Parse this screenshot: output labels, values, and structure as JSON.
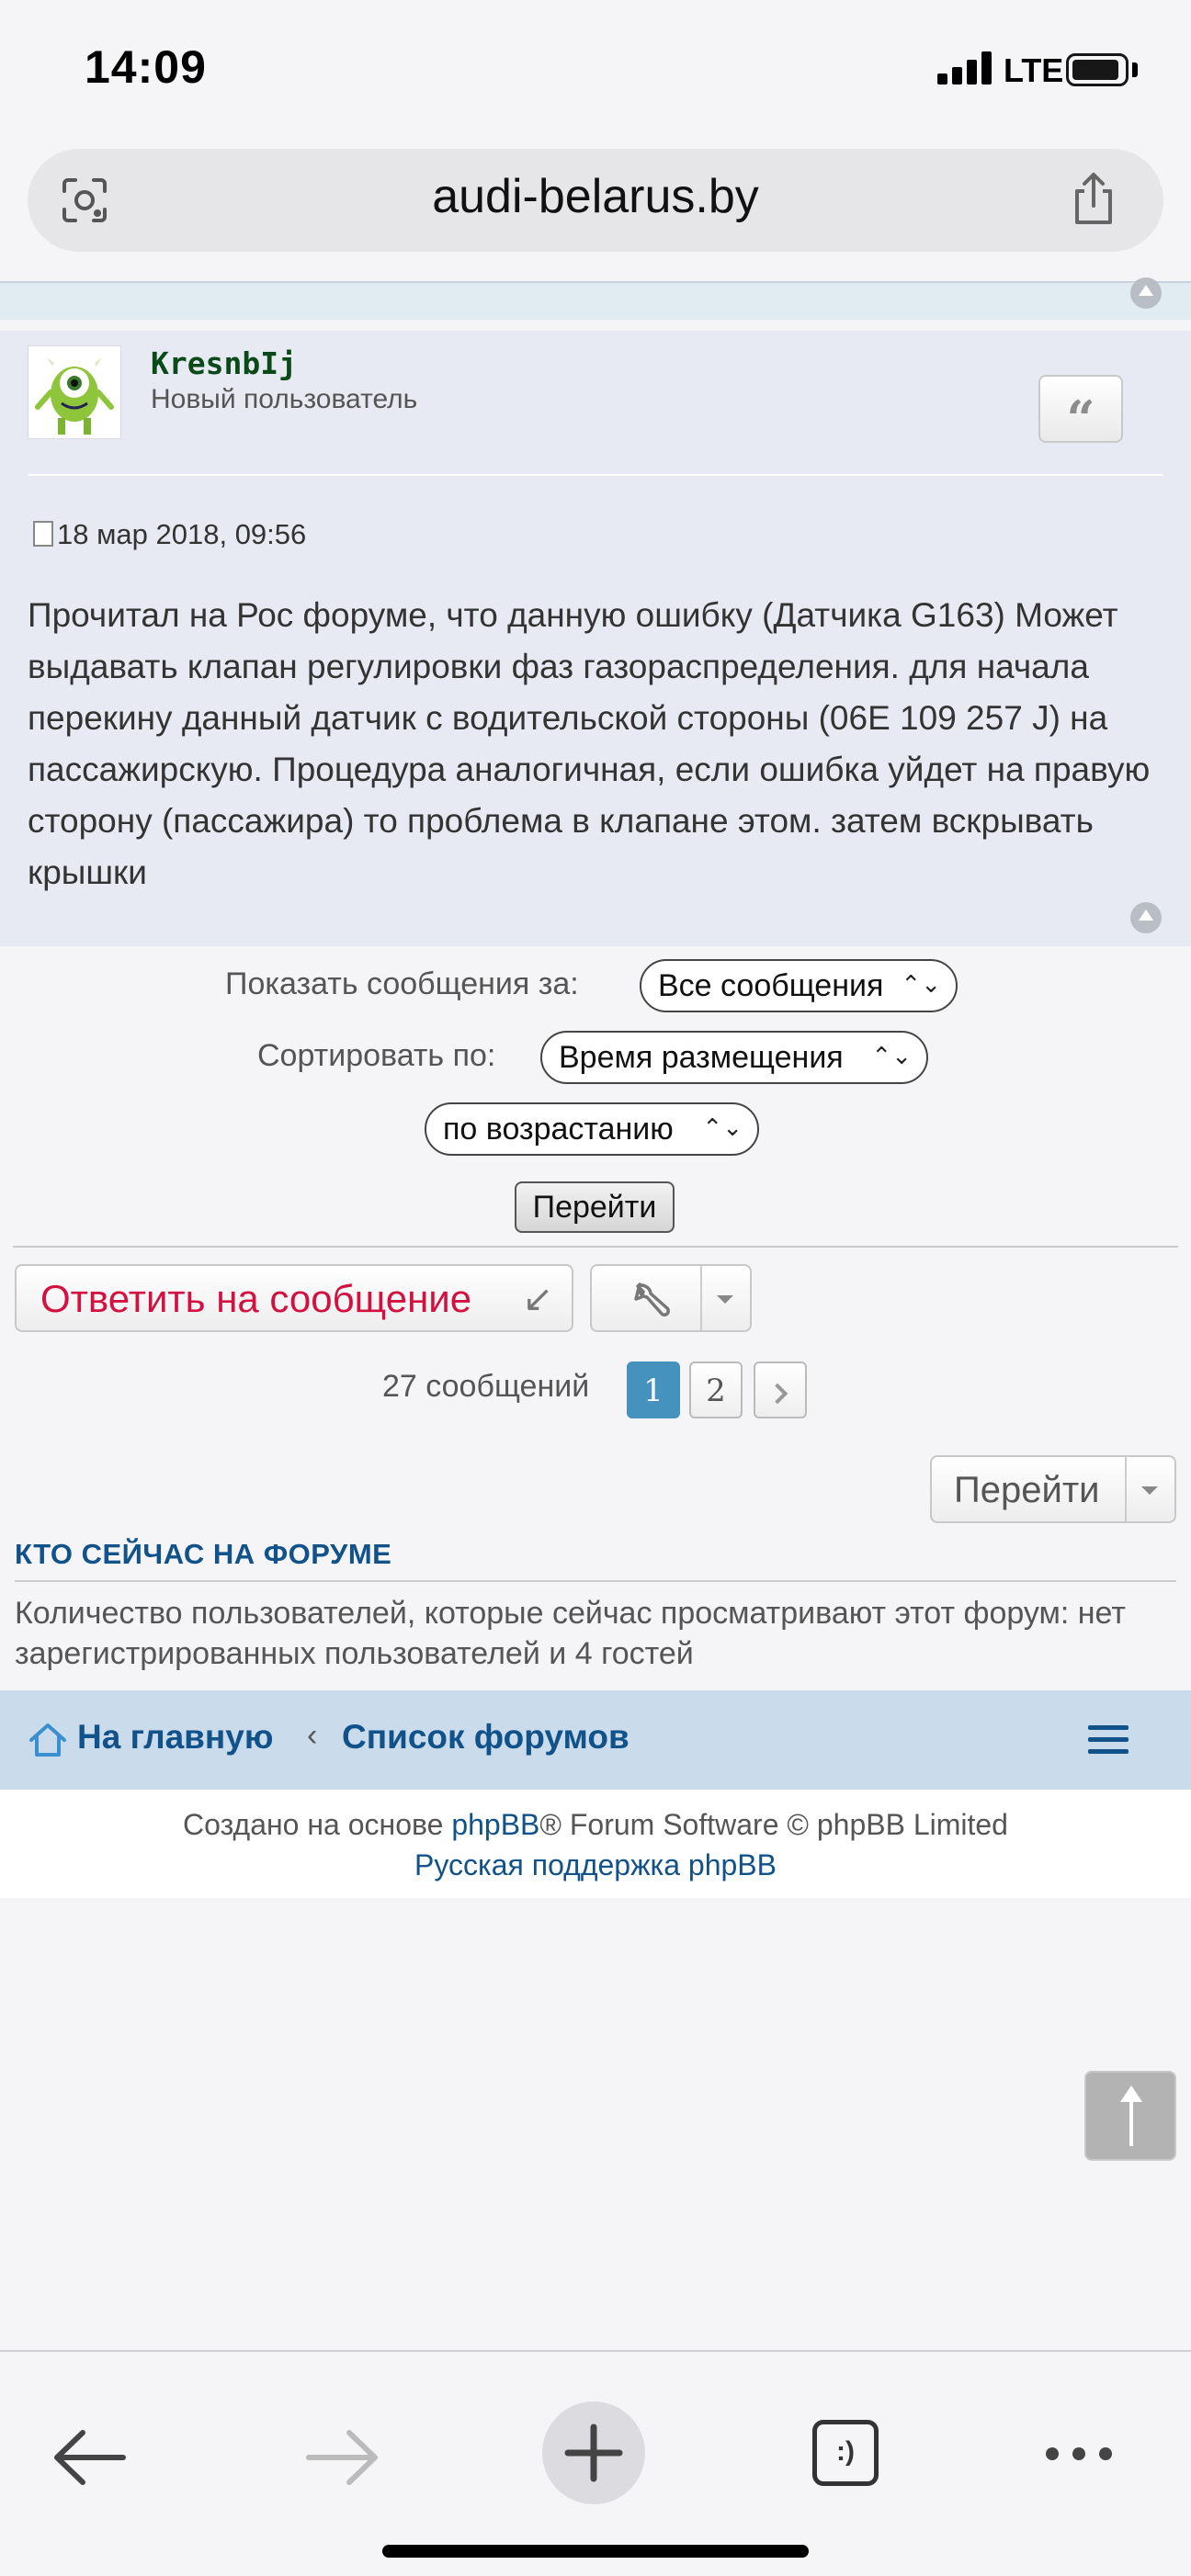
{
  "status_bar": {
    "time": "14:09",
    "network": "LTE"
  },
  "browser": {
    "url": "audi-belarus.by"
  },
  "post": {
    "username": "KresnbIj",
    "rank": "Новый пользователь",
    "quote_label": "“",
    "date": "18 мар 2018, 09:56",
    "body": "Прочитал на Рос форуме, что данную ошибку (Датчика G163) Может выдавать клапан регулировки фаз газораспределения. для начала перекину данный датчик с водительской стороны (06E 109 257 J) на пассажирскую. Процедура аналогичная, если ошибка уйдет на правую сторону (пассажира) то проблема в клапане этом. затем вскрывать крышки"
  },
  "display_options": {
    "show_label": "Показать сообщения за:",
    "show_value": "Все сообщения",
    "sort_label": "Сортировать по:",
    "sort_value": "Время размещения",
    "order_value": "по возрастанию",
    "go_label": "Перейти"
  },
  "actions": {
    "reply_label": "Ответить на сообщение",
    "reply_icon": "↙"
  },
  "pagination": {
    "count_text": "27 сообщений",
    "pages": [
      "1",
      "2"
    ],
    "current": "1"
  },
  "jump": {
    "label": "Перейти"
  },
  "whois": {
    "title": "КТО СЕЙЧАС НА ФОРУМЕ",
    "text": "Количество пользователей, которые сейчас просматривают этот форум: нет зарегистрированных пользователей и 4 гостей"
  },
  "navbar": {
    "home": "На главную",
    "separator": "‹",
    "forums": "Список форумов"
  },
  "footer": {
    "prefix": "Создано на основе ",
    "phpbb": "phpBB",
    "suffix": "® Forum Software © phpBB Limited",
    "support": "Русская поддержка phpBB"
  },
  "toolbar": {
    "tabs_label": ":)"
  },
  "colors": {
    "link": "#105289",
    "reply_text": "#d31141",
    "post_bg": "#e7eaf3",
    "nav_bg": "#cadceb",
    "active_page": "#4692bf",
    "username": "#0a4a18"
  }
}
